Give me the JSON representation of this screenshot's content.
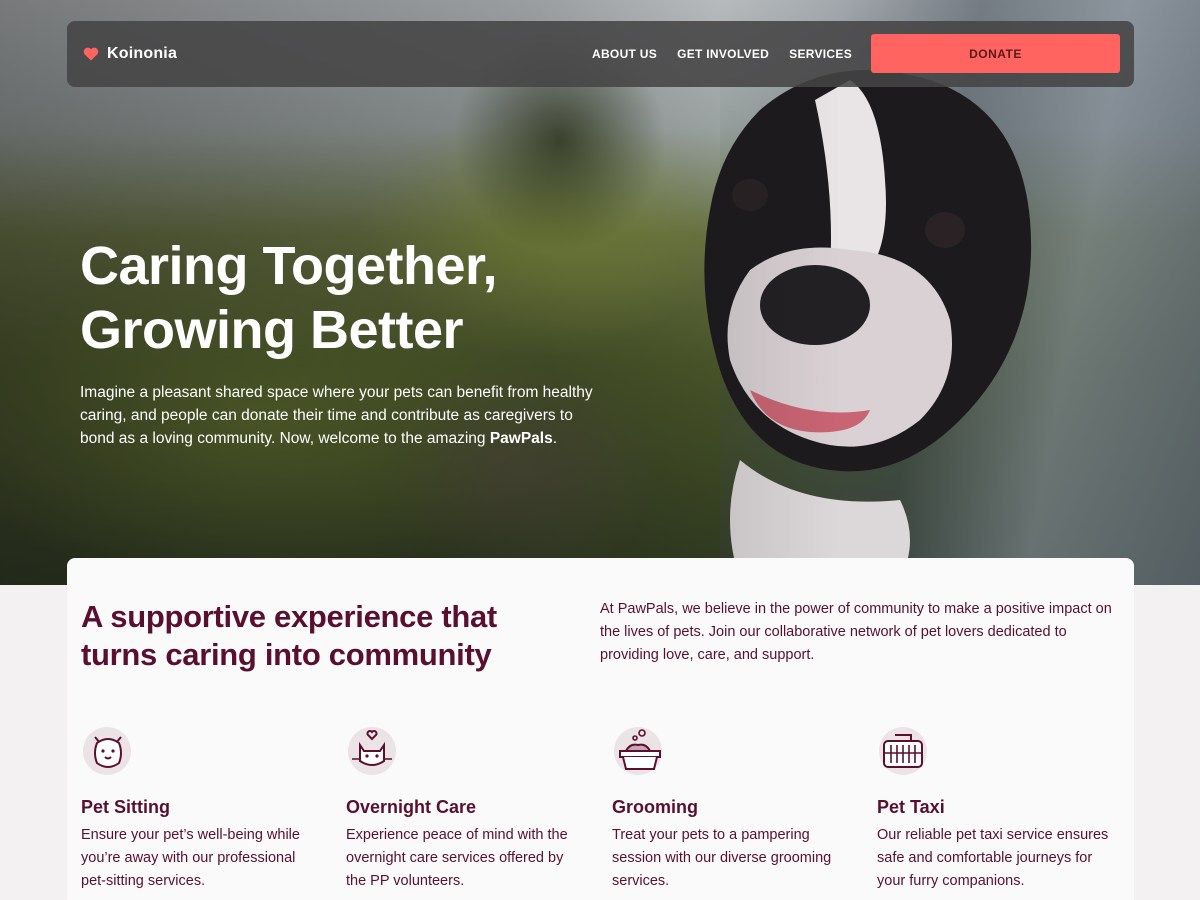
{
  "nav": {
    "brand": "Koinonia",
    "links": [
      "ABOUT US",
      "GET INVOLVED",
      "SERVICES"
    ],
    "donate_label": "DONATE"
  },
  "hero": {
    "title_line1": "Caring Together,",
    "title_line2": "Growing Better",
    "text": "Imagine a pleasant shared space where your pets can benefit from healthy caring, and people can donate their time and contribute as caregivers to bond as a loving community. Now, welcome to the amazing ",
    "text_highlight": "PawPals",
    "text_end": "."
  },
  "intro": {
    "title": "A supportive experience that turns caring into community",
    "text": "At PawPals, we believe in the power of community to make a positive impact on the lives of pets. Join our collaborative network of pet lovers dedicated to providing love, care, and support."
  },
  "services": [
    {
      "icon": "dog-face-icon",
      "title": "Pet Sitting",
      "description": "Ensure your pet’s well-being while you’re away with our professional pet-sitting services."
    },
    {
      "icon": "cat-heart-icon",
      "title": "Overnight Care",
      "description": "Experience peace of mind with the overnight care services offered by the PP volunteers."
    },
    {
      "icon": "bath-tub-icon",
      "title": "Grooming",
      "description": "Treat your pets to a pampering session with our diverse grooming services."
    },
    {
      "icon": "pet-carrier-icon",
      "title": "Pet Taxi",
      "description": "Our reliable pet taxi service ensures safe and comfortable journeys for your furry companions."
    }
  ],
  "colors": {
    "accent": "#ff6461",
    "text_dark": "#5a0f2e",
    "nav_bg": "#464446"
  }
}
